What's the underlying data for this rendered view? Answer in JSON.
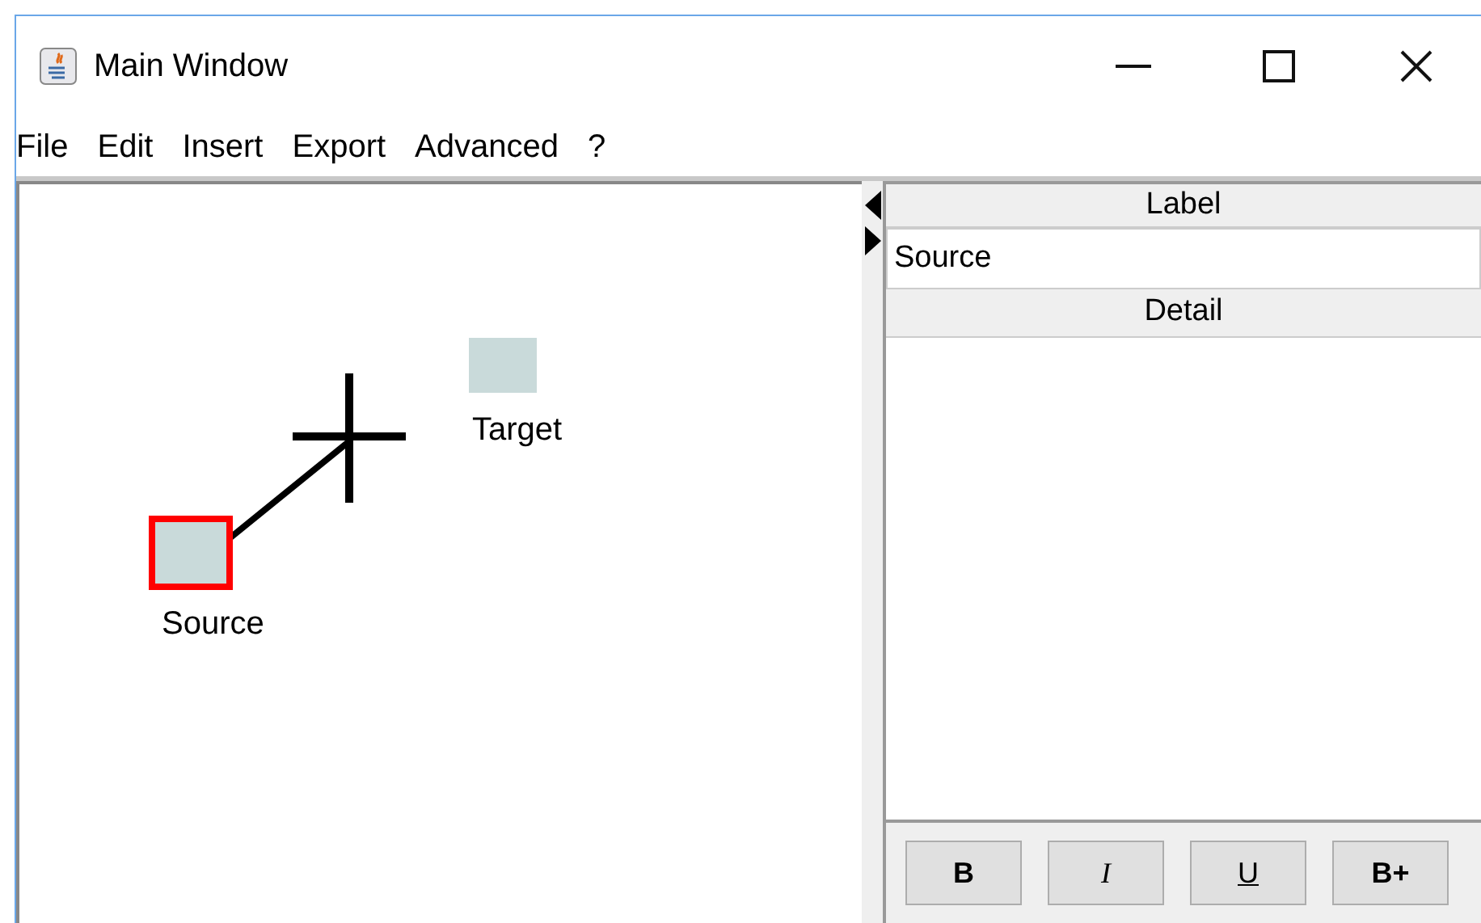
{
  "window": {
    "title": "Main Window"
  },
  "menu": [
    "File",
    "Edit",
    "Insert",
    "Export",
    "Advanced",
    "?"
  ],
  "canvas": {
    "nodes": [
      {
        "label": "Source",
        "selected": true
      },
      {
        "label": "Target",
        "selected": false
      }
    ]
  },
  "panel": {
    "label_header": "Label",
    "label_value": "Source",
    "detail_header": "Detail",
    "buttons": [
      {
        "text": "B",
        "kind": "bold"
      },
      {
        "text": "I",
        "kind": "italic"
      },
      {
        "text": "U",
        "kind": "underline"
      },
      {
        "text": "B+",
        "kind": "bold"
      }
    ]
  }
}
